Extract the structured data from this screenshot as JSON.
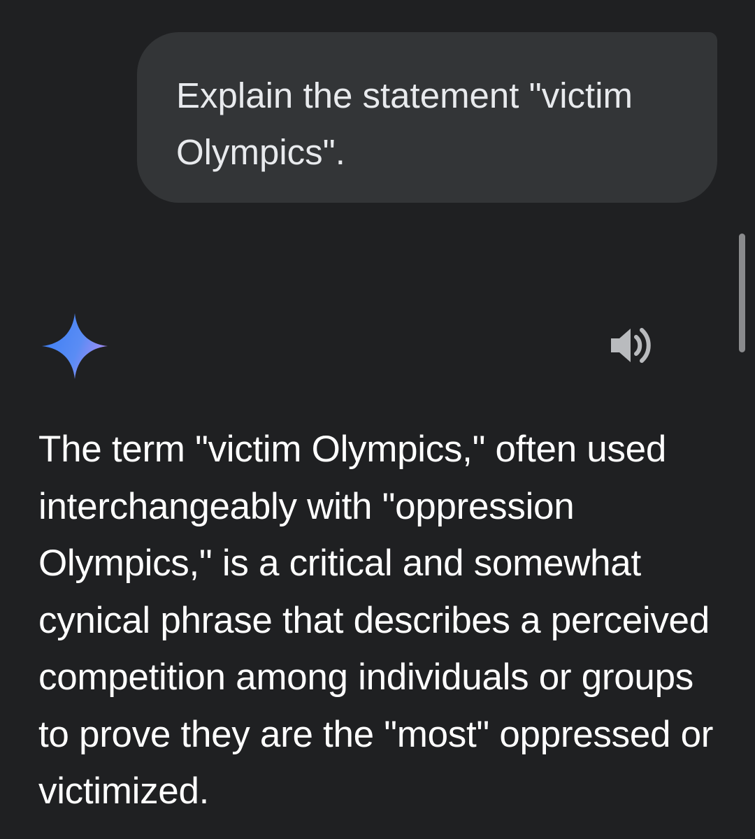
{
  "user_message": {
    "text": "Explain the statement \"victim Olympics\"."
  },
  "response": {
    "icons": {
      "assistant": "sparkle-icon",
      "read_aloud": "speaker-icon"
    },
    "text": "The term \"victim Olympics,\" often used interchangeably with \"oppression Olympics,\" is a critical and somewhat cynical phrase that describes a perceived competition among individuals or groups to prove they are the \"most\" oppressed or victimized."
  },
  "colors": {
    "background": "#1f2022",
    "user_bubble": "#333537",
    "text": "#ffffff",
    "sparkle_start": "#4a90f5",
    "sparkle_end": "#a78bfa"
  }
}
